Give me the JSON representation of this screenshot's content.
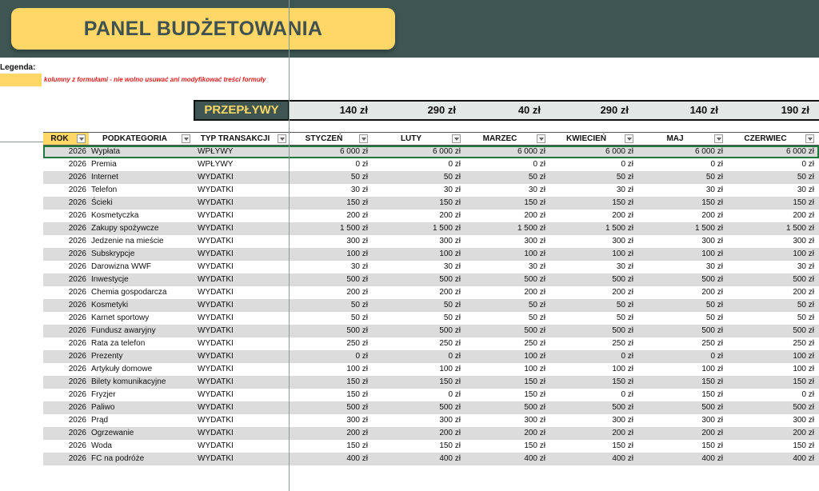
{
  "header": {
    "title": "PANEL BUDŻETOWANIA"
  },
  "legend": {
    "label": "Legenda:",
    "note": "kolumny z formułami - nie wolno usuwać ani modyfikować treści formuły"
  },
  "flows": {
    "label": "PRZEPŁYWY",
    "values": [
      "140 zł",
      "290 zł",
      "40 zł",
      "290 zł",
      "140 zł",
      "190 zł"
    ]
  },
  "table": {
    "columns": [
      "ROK",
      "PODKATEGORIA",
      "TYP TRANSAKCJI",
      "STYCZEŃ",
      "LUTY",
      "MARZEC",
      "KWIECIEŃ",
      "MAJ",
      "CZERWIEC"
    ],
    "rows": [
      [
        "2026",
        "Wypłata",
        "WPŁYWY",
        "6 000 zł",
        "6 000 zł",
        "6 000 zł",
        "6 000 zł",
        "6 000 zł",
        "6 000 zł"
      ],
      [
        "2026",
        "Premia",
        "WPŁYWY",
        "0 zł",
        "0 zł",
        "0 zł",
        "0 zł",
        "0 zł",
        "0 zł"
      ],
      [
        "2026",
        "Internet",
        "WYDATKI",
        "50 zł",
        "50 zł",
        "50 zł",
        "50 zł",
        "50 zł",
        "50 zł"
      ],
      [
        "2026",
        "Telefon",
        "WYDATKI",
        "30 zł",
        "30 zł",
        "30 zł",
        "30 zł",
        "30 zł",
        "30 zł"
      ],
      [
        "2026",
        "Ścieki",
        "WYDATKI",
        "150 zł",
        "150 zł",
        "150 zł",
        "150 zł",
        "150 zł",
        "150 zł"
      ],
      [
        "2026",
        "Kosmetyczka",
        "WYDATKI",
        "200 zł",
        "200 zł",
        "200 zł",
        "200 zł",
        "200 zł",
        "200 zł"
      ],
      [
        "2026",
        "Zakupy spożywcze",
        "WYDATKI",
        "1 500 zł",
        "1 500 zł",
        "1 500 zł",
        "1 500 zł",
        "1 500 zł",
        "1 500 zł"
      ],
      [
        "2026",
        "Jedzenie na mieście",
        "WYDATKI",
        "300 zł",
        "300 zł",
        "300 zł",
        "300 zł",
        "300 zł",
        "300 zł"
      ],
      [
        "2026",
        "Subskrypcje",
        "WYDATKI",
        "100 zł",
        "100 zł",
        "100 zł",
        "100 zł",
        "100 zł",
        "100 zł"
      ],
      [
        "2026",
        "Darowizna WWF",
        "WYDATKI",
        "30 zł",
        "30 zł",
        "30 zł",
        "30 zł",
        "30 zł",
        "30 zł"
      ],
      [
        "2026",
        "Inwestycje",
        "WYDATKI",
        "500 zł",
        "500 zł",
        "500 zł",
        "500 zł",
        "500 zł",
        "500 zł"
      ],
      [
        "2026",
        "Chemia gospodarcza",
        "WYDATKI",
        "200 zł",
        "200 zł",
        "200 zł",
        "200 zł",
        "200 zł",
        "200 zł"
      ],
      [
        "2026",
        "Kosmetyki",
        "WYDATKI",
        "50 zł",
        "50 zł",
        "50 zł",
        "50 zł",
        "50 zł",
        "50 zł"
      ],
      [
        "2026",
        "Karnet sportowy",
        "WYDATKI",
        "50 zł",
        "50 zł",
        "50 zł",
        "50 zł",
        "50 zł",
        "50 zł"
      ],
      [
        "2026",
        "Fundusz awaryjny",
        "WYDATKI",
        "500 zł",
        "500 zł",
        "500 zł",
        "500 zł",
        "500 zł",
        "500 zł"
      ],
      [
        "2026",
        "Rata za telefon",
        "WYDATKI",
        "250 zł",
        "250 zł",
        "250 zł",
        "250 zł",
        "250 zł",
        "250 zł"
      ],
      [
        "2026",
        "Prezenty",
        "WYDATKI",
        "0 zł",
        "0 zł",
        "100 zł",
        "0 zł",
        "0 zł",
        "100 zł"
      ],
      [
        "2026",
        "Artykuły domowe",
        "WYDATKI",
        "100 zł",
        "100 zł",
        "100 zł",
        "100 zł",
        "100 zł",
        "100 zł"
      ],
      [
        "2026",
        "Bilety komunikacyjne",
        "WYDATKI",
        "150 zł",
        "150 zł",
        "150 zł",
        "150 zł",
        "150 zł",
        "150 zł"
      ],
      [
        "2026",
        "Fryzjer",
        "WYDATKI",
        "150 zł",
        "0 zł",
        "150 zł",
        "0 zł",
        "150 zł",
        "0 zł"
      ],
      [
        "2026",
        "Paliwo",
        "WYDATKI",
        "500 zł",
        "500 zł",
        "500 zł",
        "500 zł",
        "500 zł",
        "500 zł"
      ],
      [
        "2026",
        "Prąd",
        "WYDATKI",
        "300 zł",
        "300 zł",
        "300 zł",
        "300 zł",
        "300 zł",
        "300 zł"
      ],
      [
        "2026",
        "Ogrzewanie",
        "WYDATKI",
        "200 zł",
        "200 zł",
        "200 zł",
        "200 zł",
        "200 zł",
        "200 zł"
      ],
      [
        "2026",
        "Woda",
        "WYDATKI",
        "150 zł",
        "150 zł",
        "150 zł",
        "150 zł",
        "150 zł",
        "150 zł"
      ],
      [
        "2026",
        "FC na podróże",
        "WYDATKI",
        "400 zł",
        "400 zł",
        "400 zł",
        "400 zł",
        "400 zł",
        "400 zł"
      ]
    ]
  },
  "colors": {
    "banner": "#3e5551",
    "accent": "#ffd766",
    "note": "#e01c1c",
    "selection": "#1d7a3a"
  }
}
